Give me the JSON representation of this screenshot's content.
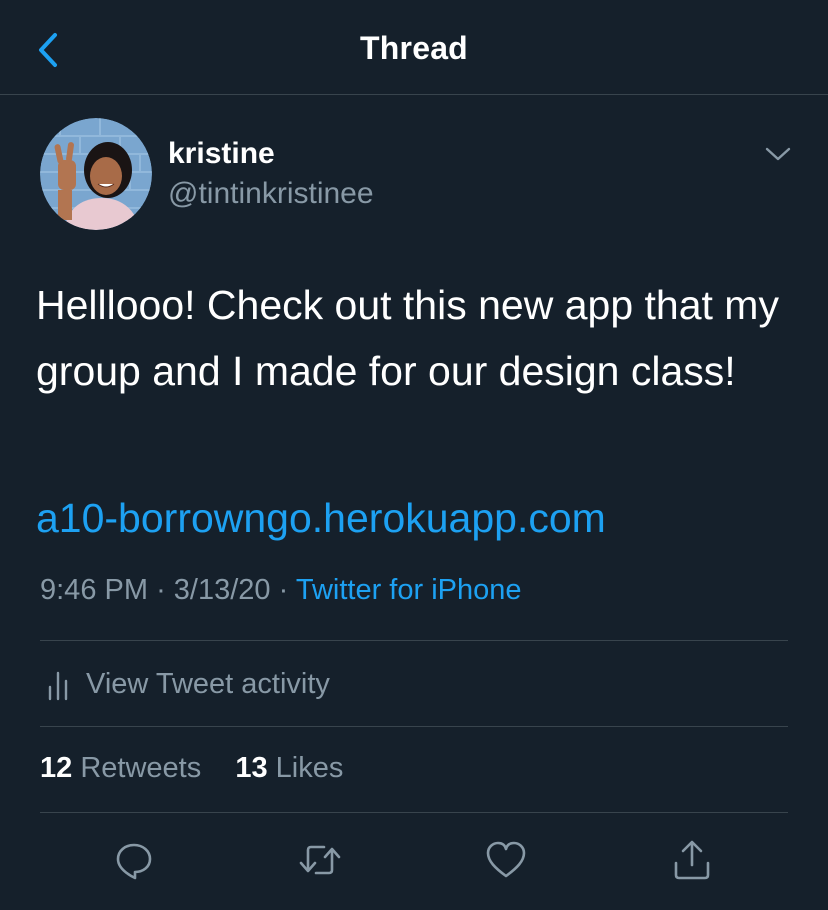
{
  "header": {
    "title": "Thread",
    "back_icon": "chevron-left-icon"
  },
  "colors": {
    "background": "#15202b",
    "divider": "#38444d",
    "muted_text": "#8899a6",
    "accent": "#1da1f2",
    "text": "#ffffff"
  },
  "author": {
    "display_name": "kristine",
    "handle": "@tintinkristinee",
    "avatar_icon": "profile-photo",
    "menu_icon": "chevron-down-icon"
  },
  "tweet": {
    "text": "Helllooo! Check out this new app that my group and I made for our design class!",
    "link": "a10-borrowngo.herokuapp.com",
    "time": "9:46 PM",
    "date": "3/13/20",
    "separator": "·",
    "source": "Twitter for iPhone"
  },
  "activity": {
    "label": "View Tweet activity",
    "icon": "bar-chart-icon"
  },
  "stats": {
    "retweets_count": "12",
    "retweets_label": "Retweets",
    "likes_count": "13",
    "likes_label": "Likes"
  },
  "actions": [
    {
      "name": "reply",
      "icon": "reply-icon"
    },
    {
      "name": "retweet",
      "icon": "retweet-icon"
    },
    {
      "name": "like",
      "icon": "heart-icon"
    },
    {
      "name": "share",
      "icon": "share-icon"
    }
  ]
}
